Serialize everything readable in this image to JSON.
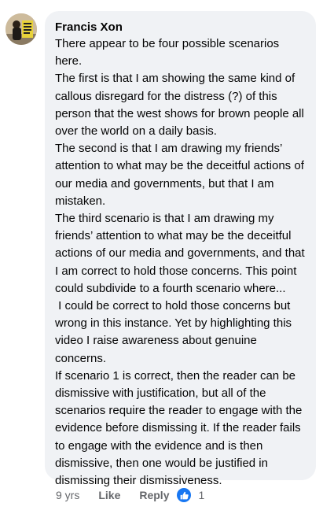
{
  "comment": {
    "author": "Francis Xon",
    "paragraphs": [
      "There appear to be four possible scenarios here.",
      "The first is that I am showing the same kind of callous disregard for the distress (?) of this person that the west shows for brown people all over the world on a daily basis.",
      "The second is that I am drawing my friends’ attention to what may be the deceitful actions of our media and governments, but that I am mistaken.",
      "The third scenario is that I am drawing my friends’ attention to what may be the deceitful actions of our media and governments, and that I am correct to hold those concerns. This point could subdivide to a fourth scenario where...",
      " I could be correct to hold those concerns but wrong in this instance. Yet by highlighting this video I raise awareness about genuine concerns.",
      "If scenario 1 is correct, then the reader can be dismissive with justification, but all of the scenarios require the reader to engage with the evidence before dismissing it. If the reader fails to engage with the evidence and is then dismissive, then one would be justified in dismissing their dismissiveness."
    ],
    "age": "9 yrs",
    "like_label": "Like",
    "reply_label": "Reply",
    "reaction_count": "1",
    "reaction_icon": "thumbs-up-icon"
  },
  "colors": {
    "bubble_bg": "#f0f2f5",
    "meta_text": "#65676b",
    "like_blue": "#1877f2"
  }
}
